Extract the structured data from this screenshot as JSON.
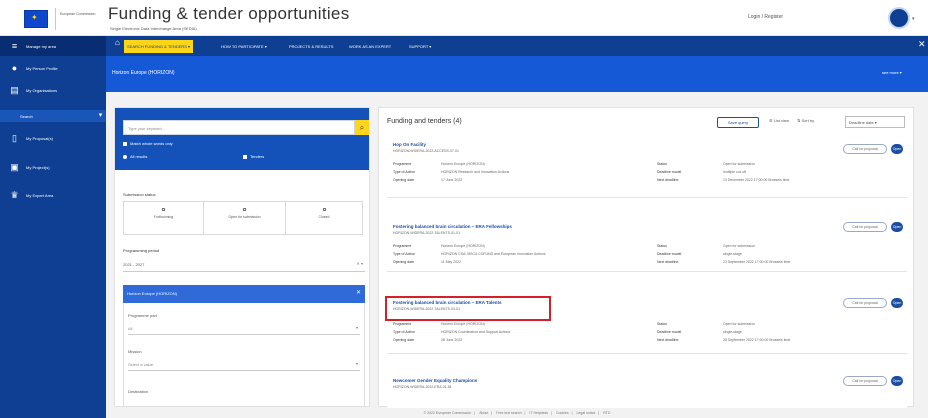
{
  "header": {
    "logo_text": "European Commission",
    "title": "Funding & tender opportunities",
    "subtitle": "Single Electronic Data Interchange Area (SEDIA)",
    "login": "Login / Register"
  },
  "sidebar": {
    "items": [
      {
        "label": "Manage my area",
        "icon": "menu-icon"
      },
      {
        "label": "My Person Profile",
        "icon": "person-icon"
      },
      {
        "label": "My Organisations",
        "icon": "building-icon"
      },
      {
        "label": "Search",
        "icon": "search-icon"
      },
      {
        "label": "My Proposal(s)",
        "icon": "document-icon"
      },
      {
        "label": "My Project(s)",
        "icon": "folder-icon"
      },
      {
        "label": "My Expert Area",
        "icon": "graduate-icon"
      }
    ]
  },
  "nav": {
    "items": [
      {
        "label": "SEARCH FUNDING & TENDERS ▾",
        "selected": true
      },
      {
        "label": "HOW TO PARTICIPATE ▾",
        "selected": false
      },
      {
        "label": "PROJECTS & RESULTS",
        "selected": false
      },
      {
        "label": "WORK AS AN EXPERT",
        "selected": false
      },
      {
        "label": "SUPPORT ▾",
        "selected": false
      }
    ]
  },
  "banner": {
    "title": "Horizon Europe (HORIZON)",
    "more": "see more ▾"
  },
  "filter": {
    "search_placeholder": "Type your keyword...",
    "exact_match": "Match whole words only",
    "radio_all": "All results",
    "radio_tenders": "Tenders",
    "status_label": "Submission status",
    "status_options": [
      "Forthcoming",
      "Open for submission",
      "Closed"
    ],
    "programming_label": "Programming period",
    "programming_value": "2021 - 2027",
    "selected_programme": "Horizon Europe (HORIZON)",
    "programme_part_label": "Programme part",
    "programme_part_value": "All",
    "mission_label": "Mission",
    "mission_placeholder": "Select a value",
    "destination_label": "Destination"
  },
  "results": {
    "title": "Funding and tenders (4)",
    "save_query": "Save query",
    "list_view": "List view",
    "sort_label": "Sort by",
    "sort_value": "Deadline date ▾",
    "meta_keys": {
      "programme": "Programme",
      "type": "Type of Action",
      "opening": "Opening date",
      "status": "Status",
      "deadline_model": "Deadline model",
      "next_deadline": "Next deadline"
    },
    "cards": [
      {
        "title": "Hop On Facility",
        "id": "HORIZON-WIDERA-2022-ACCESS-07-01",
        "programme": "Horizon Europe (HORIZON)",
        "type": "HORIZON Research and Innovation Actions",
        "opening": "17 June 2022",
        "status": "Open for submission",
        "deadline_model": "multiple cut-off",
        "next_deadline": "13 December 2022 17:00:00 Brussels time",
        "badge": "Call for proposal",
        "open": "Open"
      },
      {
        "title": "Fostering balanced brain circulation – ERA Fellowships",
        "id": "HORIZON-WIDERA-2022-TALENTS-01-01",
        "programme": "Horizon Europe (HORIZON)",
        "type": "HORIZON CSA: MSCA COFUND and European Innovation Actions",
        "opening": "11 May 2022",
        "status": "Open for submission",
        "deadline_model": "single-stage",
        "next_deadline": "23 September 2022 17:00:00 Brussels time",
        "badge": "Call for proposal",
        "open": "Open"
      },
      {
        "title": "Fostering balanced brain circulation – ERA Talents",
        "id": "HORIZON-WIDERA-2022-TALENTS-03-01",
        "programme": "Horizon Europe (HORIZON)",
        "type": "HORIZON Coordination and Support Actions",
        "opening": "08 June 2022",
        "status": "Open for submission",
        "deadline_model": "single-stage",
        "next_deadline": "28 September 2022 17:00:00 Brussels time",
        "badge": "Call for proposal",
        "open": "Open"
      },
      {
        "title": "Newcomer Gender Equality Champions",
        "id": "HORIZON-WIDERA-2022-ERA-01-81",
        "badge": "Call for proposal",
        "open": "Open"
      }
    ]
  },
  "footer": {
    "links": [
      "© 2022 European Commission",
      "About",
      "Free text search",
      "IT Helpdesk",
      "Cookies",
      "Legal notice",
      "RTD"
    ]
  },
  "colors": {
    "nav_blue": "#0e3f93",
    "banner_blue": "#1559d6",
    "accent_yellow": "#ffd617",
    "highlight_red": "#d61f26"
  }
}
